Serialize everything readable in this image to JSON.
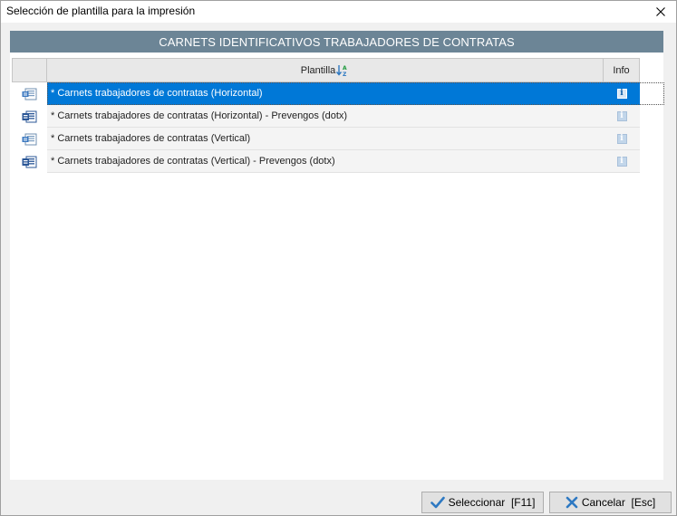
{
  "window": {
    "title": "Selección de plantilla para la impresión"
  },
  "band": {
    "title": "CARNETS IDENTIFICATIVOS TRABAJADORES DE CONTRATAS"
  },
  "grid": {
    "columns": {
      "plantilla": "Plantilla",
      "info": "Info"
    },
    "rows": [
      {
        "label": "* Carnets trabajadores de contratas (Horizontal)",
        "icon": "doc-horizontal-icon",
        "selected": true
      },
      {
        "label": "* Carnets trabajadores de contratas (Horizontal) - Prevengos (dotx)",
        "icon": "doc-word-icon",
        "selected": false
      },
      {
        "label": "* Carnets trabajadores de contratas (Vertical)",
        "icon": "doc-horizontal-icon",
        "selected": false
      },
      {
        "label": "* Carnets trabajadores de contratas (Vertical) - Prevengos (dotx)",
        "icon": "doc-word-icon",
        "selected": false
      }
    ]
  },
  "buttons": {
    "select_label": "Seleccionar  [F11]",
    "cancel_label": "Cancelar  [Esc]"
  },
  "colors": {
    "band": "#6c8596",
    "selection": "#0078d7",
    "select_check": "#2e79c2",
    "cancel_x": "#2e79c2"
  }
}
